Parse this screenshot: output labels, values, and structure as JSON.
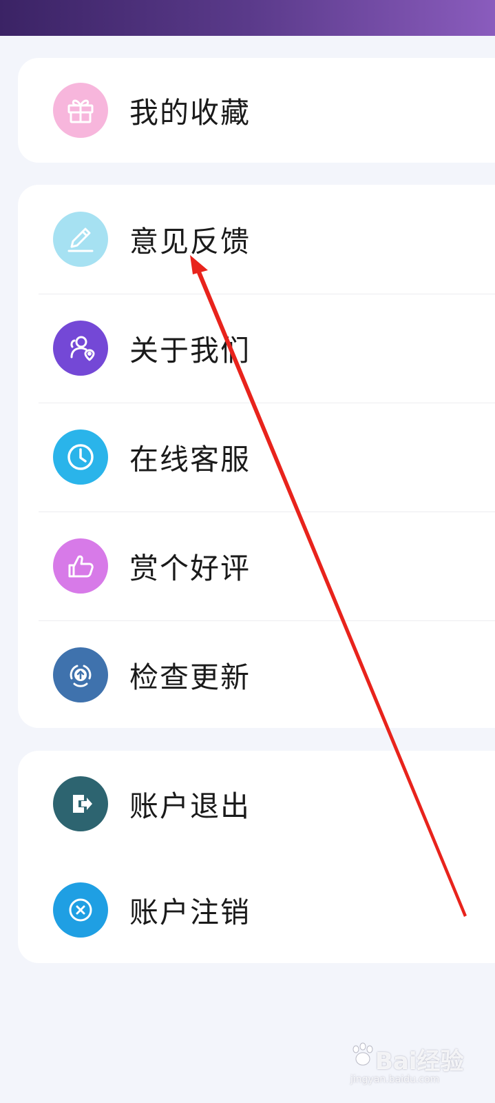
{
  "menu": {
    "group1": [
      {
        "label": "我的收藏",
        "icon": "gift-icon",
        "color": "#f7b6dc"
      }
    ],
    "group2": [
      {
        "label": "意见反馈",
        "icon": "pencil-icon",
        "color": "#a6e1f2"
      },
      {
        "label": "关于我们",
        "icon": "about-us-icon",
        "color": "#7448d6"
      },
      {
        "label": "在线客服",
        "icon": "clock-icon",
        "color": "#2ab4ea"
      },
      {
        "label": "赏个好评",
        "icon": "thumbs-up-icon",
        "color": "#d77ae8"
      },
      {
        "label": "检查更新",
        "icon": "update-arrow-icon",
        "color": "#3f72ad"
      }
    ],
    "group3": [
      {
        "label": "账户退出",
        "icon": "logout-icon",
        "color": "#2d6470"
      },
      {
        "label": "账户注销",
        "icon": "close-circle-icon",
        "color": "#1f9fe3"
      }
    ]
  },
  "colors": {
    "topbar_start": "#3b2365",
    "topbar_end": "#8a5cbd",
    "page_background": "#f3f5fb",
    "annotation_arrow": "#e8231c"
  },
  "watermark": {
    "brand": "Bai经验",
    "url": "jingyan.baidu.com"
  }
}
